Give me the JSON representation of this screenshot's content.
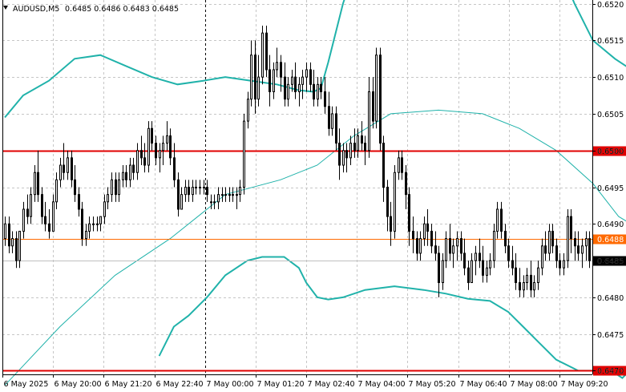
{
  "header": {
    "symbol": "AUDUSD,M5",
    "ohlc": "0.6485 0.6486 0.6483 0.6485"
  },
  "chart_data": {
    "type": "candlestick",
    "symbol": "AUDUSD",
    "timeframe": "M5",
    "ylim": [
      0.64695,
      0.65205
    ],
    "y_ticks": [
      "0.6520",
      "0.6515",
      "0.6510",
      "0.6505",
      "0.6500",
      "0.6495",
      "0.6490",
      "0.6485",
      "0.6480",
      "0.6475",
      "0.6470"
    ],
    "x_ticks": [
      "6 May 2025",
      "6 May 20:00",
      "6 May 21:20",
      "6 May 22:40",
      "7 May 00:00",
      "7 May 01:20",
      "7 May 02:40",
      "7 May 04:00",
      "7 May 05:20",
      "7 May 06:40",
      "7 May 08:00",
      "7 May 09:20"
    ],
    "grid": true,
    "levels": [
      {
        "label": "0.6500",
        "value": 0.65,
        "color": "#e00000"
      },
      {
        "label": "0.6488",
        "value": 0.6488,
        "color": "#ff6a00"
      },
      {
        "label": "0.6470",
        "value": 0.647,
        "color": "#e00000"
      }
    ],
    "current_price": {
      "label": "0.6485",
      "value": 0.6485
    },
    "session_separator_time": "7 May 00:00",
    "bollinger_upper": [
      [
        0,
        0.65045
      ],
      [
        5,
        0.65075
      ],
      [
        12,
        0.65095
      ],
      [
        19,
        0.65125
      ],
      [
        26,
        0.6513
      ],
      [
        33,
        0.65115
      ],
      [
        40,
        0.651
      ],
      [
        47,
        0.6509
      ],
      [
        54,
        0.65095
      ],
      [
        60,
        0.651
      ],
      [
        67,
        0.65095
      ],
      [
        74,
        0.6509
      ],
      [
        80,
        0.65082
      ],
      [
        84,
        0.6508
      ],
      [
        86,
        0.65085
      ],
      [
        88,
        0.6512
      ],
      [
        90,
        0.6516
      ],
      [
        92,
        0.652
      ],
      [
        94,
        0.6523
      ],
      [
        96,
        0.6526
      ],
      [
        150,
        0.6526
      ],
      [
        155,
        0.652
      ],
      [
        160,
        0.6515
      ],
      [
        166,
        0.65125
      ],
      [
        172,
        0.65105
      ],
      [
        175,
        0.65085
      ],
      [
        177,
        0.6503
      ],
      [
        180,
        0.65007
      ],
      [
        184,
        0.65
      ]
    ],
    "bollinger_middle": [
      [
        0,
        0.6468
      ],
      [
        15,
        0.6476
      ],
      [
        30,
        0.6483
      ],
      [
        45,
        0.6488
      ],
      [
        60,
        0.6494
      ],
      [
        75,
        0.6496
      ],
      [
        85,
        0.6498
      ],
      [
        95,
        0.6502
      ],
      [
        105,
        0.6505
      ],
      [
        118,
        0.65055
      ],
      [
        130,
        0.6505
      ],
      [
        140,
        0.6503
      ],
      [
        150,
        0.65
      ],
      [
        160,
        0.64955
      ],
      [
        167,
        0.6491
      ],
      [
        172,
        0.64895
      ],
      [
        178,
        0.64885
      ],
      [
        184,
        0.6488
      ]
    ],
    "bollinger_lower": [
      [
        42,
        0.6472
      ],
      [
        46,
        0.6476
      ],
      [
        50,
        0.64775
      ],
      [
        55,
        0.648
      ],
      [
        60,
        0.6483
      ],
      [
        66,
        0.6485
      ],
      [
        70,
        0.64855
      ],
      [
        76,
        0.64855
      ],
      [
        80,
        0.6484
      ],
      [
        82,
        0.6482
      ],
      [
        85,
        0.648
      ],
      [
        88,
        0.64797
      ],
      [
        92,
        0.648
      ],
      [
        98,
        0.6481
      ],
      [
        106,
        0.64815
      ],
      [
        114,
        0.6481
      ],
      [
        120,
        0.64805
      ],
      [
        126,
        0.64798
      ],
      [
        132,
        0.64795
      ],
      [
        137,
        0.6478
      ],
      [
        141,
        0.6476
      ],
      [
        145,
        0.6474
      ],
      [
        150,
        0.64715
      ],
      [
        156,
        0.647
      ],
      [
        160,
        0.647
      ],
      [
        165,
        0.647
      ],
      [
        168,
        0.6469
      ],
      [
        172,
        0.6471
      ],
      [
        175,
        0.6474
      ],
      [
        178,
        0.6476
      ],
      [
        181,
        0.64762
      ],
      [
        184,
        0.6476
      ]
    ],
    "candles": [
      [
        0.6488,
        0.6491,
        0.6487,
        0.649
      ],
      [
        0.649,
        0.6491,
        0.6486,
        0.6487
      ],
      [
        0.6487,
        0.6489,
        0.6486,
        0.6488
      ],
      [
        0.6488,
        0.6489,
        0.6484,
        0.6485
      ],
      [
        0.6485,
        0.6489,
        0.6484,
        0.6489
      ],
      [
        0.6489,
        0.6493,
        0.6488,
        0.6492
      ],
      [
        0.6492,
        0.6494,
        0.649,
        0.6491
      ],
      [
        0.6491,
        0.6495,
        0.649,
        0.6494
      ],
      [
        0.6494,
        0.6498,
        0.6493,
        0.6497
      ],
      [
        0.6497,
        0.65,
        0.6493,
        0.6494
      ],
      [
        0.6494,
        0.6495,
        0.649,
        0.6491
      ],
      [
        0.6491,
        0.6493,
        0.6489,
        0.649
      ],
      [
        0.649,
        0.6492,
        0.6488,
        0.6489
      ],
      [
        0.6489,
        0.6494,
        0.6489,
        0.6493
      ],
      [
        0.6493,
        0.6497,
        0.6492,
        0.6496
      ],
      [
        0.6496,
        0.6499,
        0.6495,
        0.6498
      ],
      [
        0.6498,
        0.6501,
        0.6496,
        0.6497
      ],
      [
        0.6497,
        0.65,
        0.6496,
        0.6499
      ],
      [
        0.6499,
        0.65,
        0.6495,
        0.6496
      ],
      [
        0.6496,
        0.6498,
        0.6493,
        0.6494
      ],
      [
        0.6494,
        0.6495,
        0.6491,
        0.6492
      ],
      [
        0.6492,
        0.6493,
        0.6487,
        0.6488
      ],
      [
        0.6488,
        0.649,
        0.6487,
        0.6489
      ],
      [
        0.6489,
        0.6491,
        0.6488,
        0.649
      ],
      [
        0.649,
        0.6491,
        0.6489,
        0.649
      ],
      [
        0.649,
        0.6491,
        0.6489,
        0.649
      ],
      [
        0.649,
        0.6491,
        0.6489,
        0.6491
      ],
      [
        0.6491,
        0.6494,
        0.649,
        0.6493
      ],
      [
        0.6493,
        0.6495,
        0.6492,
        0.6494
      ],
      [
        0.6494,
        0.6497,
        0.6493,
        0.6496
      ],
      [
        0.6496,
        0.6497,
        0.6493,
        0.6494
      ],
      [
        0.6494,
        0.6497,
        0.6493,
        0.6496
      ],
      [
        0.6496,
        0.6498,
        0.6495,
        0.6497
      ],
      [
        0.6497,
        0.6498,
        0.6495,
        0.6496
      ],
      [
        0.6496,
        0.6499,
        0.6495,
        0.6498
      ],
      [
        0.6498,
        0.6499,
        0.6496,
        0.6497
      ],
      [
        0.6497,
        0.6501,
        0.6496,
        0.65
      ],
      [
        0.65,
        0.6502,
        0.6498,
        0.6499
      ],
      [
        0.6499,
        0.6501,
        0.6497,
        0.6498
      ],
      [
        0.6498,
        0.6504,
        0.6497,
        0.6503
      ],
      [
        0.6503,
        0.6504,
        0.65,
        0.6501
      ],
      [
        0.6501,
        0.6502,
        0.6498,
        0.6499
      ],
      [
        0.6499,
        0.6501,
        0.6497,
        0.65
      ],
      [
        0.65,
        0.6502,
        0.6498,
        0.6501
      ],
      [
        0.6501,
        0.6504,
        0.65,
        0.6502
      ],
      [
        0.6502,
        0.6503,
        0.6498,
        0.6499
      ],
      [
        0.6499,
        0.6501,
        0.6495,
        0.6496
      ],
      [
        0.6496,
        0.6497,
        0.6491,
        0.6492
      ],
      [
        0.6492,
        0.6495,
        0.6492,
        0.6494
      ],
      [
        0.6494,
        0.6496,
        0.6493,
        0.6495
      ],
      [
        0.6495,
        0.6496,
        0.6493,
        0.6494
      ],
      [
        0.6494,
        0.6496,
        0.6493,
        0.6495
      ],
      [
        0.6495,
        0.6496,
        0.6494,
        0.6495
      ],
      [
        0.6495,
        0.6496,
        0.6494,
        0.6495
      ],
      [
        0.6495,
        0.6496,
        0.6494,
        0.6495
      ],
      [
        0.6495,
        0.6496,
        0.6493,
        0.6494
      ],
      [
        0.6493,
        0.6494,
        0.6492,
        0.6493
      ],
      [
        0.6493,
        0.6494,
        0.6492,
        0.6493
      ],
      [
        0.6493,
        0.6495,
        0.6492,
        0.6494
      ],
      [
        0.6494,
        0.6495,
        0.6493,
        0.6494
      ],
      [
        0.6494,
        0.6495,
        0.6493,
        0.6494
      ],
      [
        0.6494,
        0.6495,
        0.6493,
        0.6494
      ],
      [
        0.6494,
        0.6495,
        0.6493,
        0.6494
      ],
      [
        0.6494,
        0.6495,
        0.6492,
        0.6494
      ],
      [
        0.6494,
        0.6496,
        0.6493,
        0.6495
      ],
      [
        0.6495,
        0.6505,
        0.6494,
        0.6504
      ],
      [
        0.6504,
        0.6508,
        0.6503,
        0.6507
      ],
      [
        0.6507,
        0.6515,
        0.6506,
        0.6513
      ],
      [
        0.6513,
        0.6515,
        0.6505,
        0.6507
      ],
      [
        0.6507,
        0.6513,
        0.6506,
        0.651
      ],
      [
        0.651,
        0.6517,
        0.6509,
        0.6516
      ],
      [
        0.6516,
        0.6517,
        0.651,
        0.6511
      ],
      [
        0.6511,
        0.6513,
        0.6506,
        0.6508
      ],
      [
        0.6508,
        0.6512,
        0.6507,
        0.6511
      ],
      [
        0.6511,
        0.6514,
        0.651,
        0.6512
      ],
      [
        0.6512,
        0.6513,
        0.6508,
        0.651
      ],
      [
        0.651,
        0.6512,
        0.6506,
        0.6507
      ],
      [
        0.6507,
        0.651,
        0.6506,
        0.6509
      ],
      [
        0.6509,
        0.6511,
        0.6508,
        0.651
      ],
      [
        0.651,
        0.6512,
        0.6507,
        0.6508
      ],
      [
        0.6508,
        0.651,
        0.6506,
        0.6509
      ],
      [
        0.6509,
        0.6511,
        0.6507,
        0.651
      ],
      [
        0.651,
        0.6512,
        0.6508,
        0.6511
      ],
      [
        0.6511,
        0.6512,
        0.6508,
        0.6509
      ],
      [
        0.6509,
        0.6511,
        0.6506,
        0.6507
      ],
      [
        0.6507,
        0.651,
        0.6506,
        0.6509
      ],
      [
        0.6509,
        0.651,
        0.6507,
        0.6508
      ],
      [
        0.6508,
        0.651,
        0.6505,
        0.6506
      ],
      [
        0.6506,
        0.6508,
        0.6502,
        0.6503
      ],
      [
        0.6503,
        0.6506,
        0.6502,
        0.6505
      ],
      [
        0.6505,
        0.6506,
        0.65,
        0.6501
      ],
      [
        0.6501,
        0.6503,
        0.6496,
        0.6498
      ],
      [
        0.6498,
        0.6501,
        0.6497,
        0.65
      ],
      [
        0.65,
        0.6501,
        0.6497,
        0.6499
      ],
      [
        0.6499,
        0.6502,
        0.6498,
        0.6501
      ],
      [
        0.6501,
        0.6503,
        0.6499,
        0.65
      ],
      [
        0.65,
        0.6503,
        0.6499,
        0.6502
      ],
      [
        0.6502,
        0.6504,
        0.65,
        0.6501
      ],
      [
        0.6501,
        0.6502,
        0.6498,
        0.65
      ],
      [
        0.65,
        0.651,
        0.6499,
        0.6508
      ],
      [
        0.6508,
        0.651,
        0.6503,
        0.6504
      ],
      [
        0.6504,
        0.6514,
        0.6503,
        0.6513
      ],
      [
        0.6513,
        0.6514,
        0.65,
        0.6501
      ],
      [
        0.6501,
        0.6502,
        0.6493,
        0.6495
      ],
      [
        0.6495,
        0.6496,
        0.6489,
        0.6491
      ],
      [
        0.6491,
        0.6493,
        0.6487,
        0.6489
      ],
      [
        0.6489,
        0.6498,
        0.6488,
        0.6497
      ],
      [
        0.6497,
        0.65,
        0.6496,
        0.6499
      ],
      [
        0.6499,
        0.65,
        0.6496,
        0.6497
      ],
      [
        0.6497,
        0.6498,
        0.6492,
        0.6494
      ],
      [
        0.6494,
        0.6495,
        0.6487,
        0.6489
      ],
      [
        0.6489,
        0.6491,
        0.6486,
        0.6488
      ],
      [
        0.6488,
        0.6489,
        0.6485,
        0.6486
      ],
      [
        0.6486,
        0.6489,
        0.6485,
        0.6488
      ],
      [
        0.6488,
        0.6491,
        0.6487,
        0.649
      ],
      [
        0.649,
        0.6492,
        0.6487,
        0.6489
      ],
      [
        0.6489,
        0.649,
        0.6486,
        0.6487
      ],
      [
        0.6487,
        0.6489,
        0.6485,
        0.6486
      ],
      [
        0.6486,
        0.6487,
        0.648,
        0.6482
      ],
      [
        0.6482,
        0.6486,
        0.6481,
        0.6485
      ],
      [
        0.6485,
        0.6489,
        0.6484,
        0.6488
      ],
      [
        0.6488,
        0.649,
        0.6485,
        0.6486
      ],
      [
        0.6486,
        0.6488,
        0.6484,
        0.6487
      ],
      [
        0.6487,
        0.6489,
        0.6485,
        0.6488
      ],
      [
        0.6488,
        0.6489,
        0.6485,
        0.6486
      ],
      [
        0.6486,
        0.6488,
        0.6483,
        0.6484
      ],
      [
        0.6484,
        0.6485,
        0.6481,
        0.6482
      ],
      [
        0.6482,
        0.6486,
        0.6482,
        0.6485
      ],
      [
        0.6485,
        0.6487,
        0.6483,
        0.6486
      ],
      [
        0.6486,
        0.6488,
        0.6484,
        0.6485
      ],
      [
        0.6485,
        0.6487,
        0.6482,
        0.6483
      ],
      [
        0.6483,
        0.6485,
        0.6482,
        0.6484
      ],
      [
        0.6484,
        0.6486,
        0.6483,
        0.6485
      ],
      [
        0.6485,
        0.649,
        0.6484,
        0.6489
      ],
      [
        0.6489,
        0.6493,
        0.6488,
        0.6492
      ],
      [
        0.6492,
        0.6493,
        0.6488,
        0.6489
      ],
      [
        0.6489,
        0.649,
        0.6486,
        0.6487
      ],
      [
        0.6487,
        0.6488,
        0.6484,
        0.6485
      ],
      [
        0.6485,
        0.6487,
        0.6483,
        0.6484
      ],
      [
        0.6484,
        0.6486,
        0.6481,
        0.6482
      ],
      [
        0.6482,
        0.6484,
        0.648,
        0.6481
      ],
      [
        0.6481,
        0.6483,
        0.648,
        0.6482
      ],
      [
        0.6482,
        0.6484,
        0.6481,
        0.6483
      ],
      [
        0.6483,
        0.6485,
        0.648,
        0.6481
      ],
      [
        0.6481,
        0.6483,
        0.648,
        0.6482
      ],
      [
        0.6482,
        0.6485,
        0.6481,
        0.6484
      ],
      [
        0.6484,
        0.6488,
        0.6483,
        0.6487
      ],
      [
        0.6487,
        0.6489,
        0.6485,
        0.6486
      ],
      [
        0.6486,
        0.649,
        0.6485,
        0.6489
      ],
      [
        0.6489,
        0.649,
        0.6486,
        0.6487
      ],
      [
        0.6487,
        0.6488,
        0.6484,
        0.6485
      ],
      [
        0.6485,
        0.6486,
        0.6483,
        0.6484
      ],
      [
        0.6484,
        0.6486,
        0.6483,
        0.6485
      ],
      [
        0.6485,
        0.6492,
        0.6484,
        0.6491
      ],
      [
        0.6491,
        0.6492,
        0.6486,
        0.6488
      ],
      [
        0.6488,
        0.6489,
        0.6485,
        0.6487
      ],
      [
        0.6487,
        0.6489,
        0.6485,
        0.6486
      ],
      [
        0.6486,
        0.6488,
        0.6484,
        0.6487
      ],
      [
        0.6487,
        0.6489,
        0.6485,
        0.6488
      ],
      [
        0.6488,
        0.6489,
        0.6484,
        0.6485
      ]
    ]
  }
}
